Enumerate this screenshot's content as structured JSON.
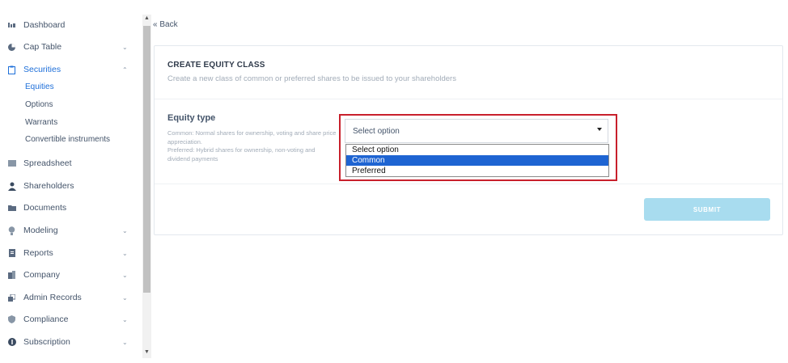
{
  "sidebar": {
    "items": [
      {
        "label": "Dashboard",
        "icon": "bar-chart-icon",
        "chevron": ""
      },
      {
        "label": "Cap Table",
        "icon": "pie-chart-icon",
        "chevron": "⌄"
      },
      {
        "label": "Securities",
        "icon": "clipboard-icon",
        "chevron": "⌃"
      },
      {
        "label": "Spreadsheet",
        "icon": "spreadsheet-icon",
        "chevron": ""
      },
      {
        "label": "Shareholders",
        "icon": "user-icon",
        "chevron": ""
      },
      {
        "label": "Documents",
        "icon": "folder-icon",
        "chevron": ""
      },
      {
        "label": "Modeling",
        "icon": "lightbulb-icon",
        "chevron": "⌄"
      },
      {
        "label": "Reports",
        "icon": "report-icon",
        "chevron": "⌄"
      },
      {
        "label": "Company",
        "icon": "building-icon",
        "chevron": "⌄"
      },
      {
        "label": "Admin Records",
        "icon": "admin-records-icon",
        "chevron": "⌄"
      },
      {
        "label": "Compliance",
        "icon": "shield-icon",
        "chevron": "⌄"
      },
      {
        "label": "Subscription",
        "icon": "dollar-icon",
        "chevron": "⌄"
      }
    ],
    "sub_items": [
      "Equities",
      "Options",
      "Warrants",
      "Convertible instruments"
    ]
  },
  "back_label": "« Back",
  "card": {
    "title": "CREATE EQUITY CLASS",
    "subtitle": "Create a new class of common or preferred shares to be issued to your shareholders",
    "field_label": "Equity type",
    "field_help_1": "Common: Normal shares for ownership, voting and share price appreciation.",
    "field_help_2": "Preferred: Hybrid shares for ownership, non-voting and dividend payments",
    "select_value": "Select option",
    "options": [
      "Select option",
      "Common",
      "Preferred"
    ],
    "submit_label": "SUBMIT"
  },
  "colors": {
    "accent": "#1e6fd9",
    "highlight_border": "#c8202c",
    "submit_bg": "#a8dcef",
    "option_selected_bg": "#1e64d2"
  }
}
